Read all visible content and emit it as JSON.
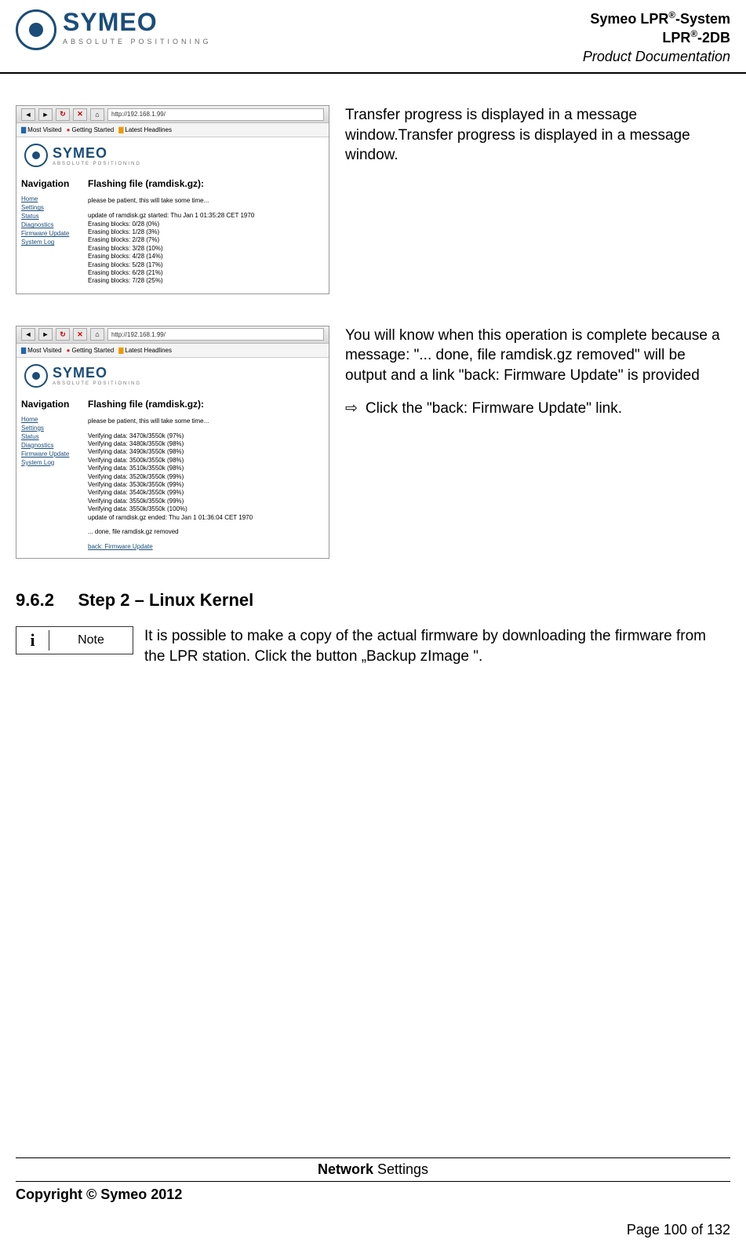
{
  "header": {
    "logo_text": "SYMEO",
    "logo_sub": "ABSOLUTE POSITIONING",
    "line1a": "Symeo LPR",
    "line1b": "-System",
    "line2a": "LPR",
    "line2b": "-2DB",
    "line3": "Product Documentation",
    "sup": "®"
  },
  "screenshot_common": {
    "url": "http://192.168.1.99/",
    "bookmarks": {
      "most": "Most Visited",
      "getting": "Getting Started",
      "latest": "Latest Headlines"
    },
    "logo_text": "SYMEO",
    "logo_sub": "ABSOLUTE POSITIONING",
    "nav_title": "Navigation",
    "nav": [
      "Home",
      "Settings",
      "Status",
      "Diagnostics",
      "Firmware Update",
      "System Log"
    ],
    "main_title": "Flashing file (ramdisk.gz):",
    "wait_text": "please be patient, this will take some time..."
  },
  "screenshot1": {
    "lines": [
      "update of ramdisk.gz started: Thu Jan 1 01:35:28 CET 1970",
      "Erasing blocks: 0/28 (0%)",
      "Erasing blocks: 1/28 (3%)",
      "Erasing blocks: 2/28 (7%)",
      "Erasing blocks: 3/28 (10%)",
      "Erasing blocks: 4/28 (14%)",
      "Erasing blocks: 5/28 (17%)",
      "Erasing blocks: 6/28 (21%)",
      "Erasing blocks: 7/28 (25%)"
    ]
  },
  "screenshot2": {
    "lines": [
      "Verifying data: 3470k/3550k (97%)",
      "Verifying data: 3480k/3550k (98%)",
      "Verifying data: 3490k/3550k (98%)",
      "Verifying data: 3500k/3550k (98%)",
      "Verifying data: 3510k/3550k (98%)",
      "Verifying data: 3520k/3550k (99%)",
      "Verifying data: 3530k/3550k (99%)",
      "Verifying data: 3540k/3550k (99%)",
      "Verifying data: 3550k/3550k (99%)",
      "Verifying data: 3550k/3550k (100%)",
      "update of ramdisk.gz ended: Thu Jan 1 01:36:04 CET 1970"
    ],
    "done_text": "... done, file ramdisk.gz removed",
    "back_link": "back: Firmware Update"
  },
  "desc1": "Transfer progress is displayed in a message window.Transfer progress is displayed in a message window.",
  "desc2": "You will know when this operation is complete because a message: \"...  done, file ramdisk.gz removed\" will be output and a link \"back: Firmware Update\" is provided",
  "desc2_action": "Click the \"back: Firmware Update\" link.",
  "section": {
    "num": "9.6.2",
    "title": "Step 2 – Linux Kernel"
  },
  "note": {
    "icon": "i",
    "label": "Note",
    "text": "It is possible to make a copy of the actual firmware by downloading the firmware from the LPR station. Click the button „Backup zImage \"."
  },
  "footer": {
    "section_bold": "Network",
    "section_rest": " Settings",
    "copyright": "Copyright © Symeo 2012",
    "page": "Page 100 of 132"
  }
}
